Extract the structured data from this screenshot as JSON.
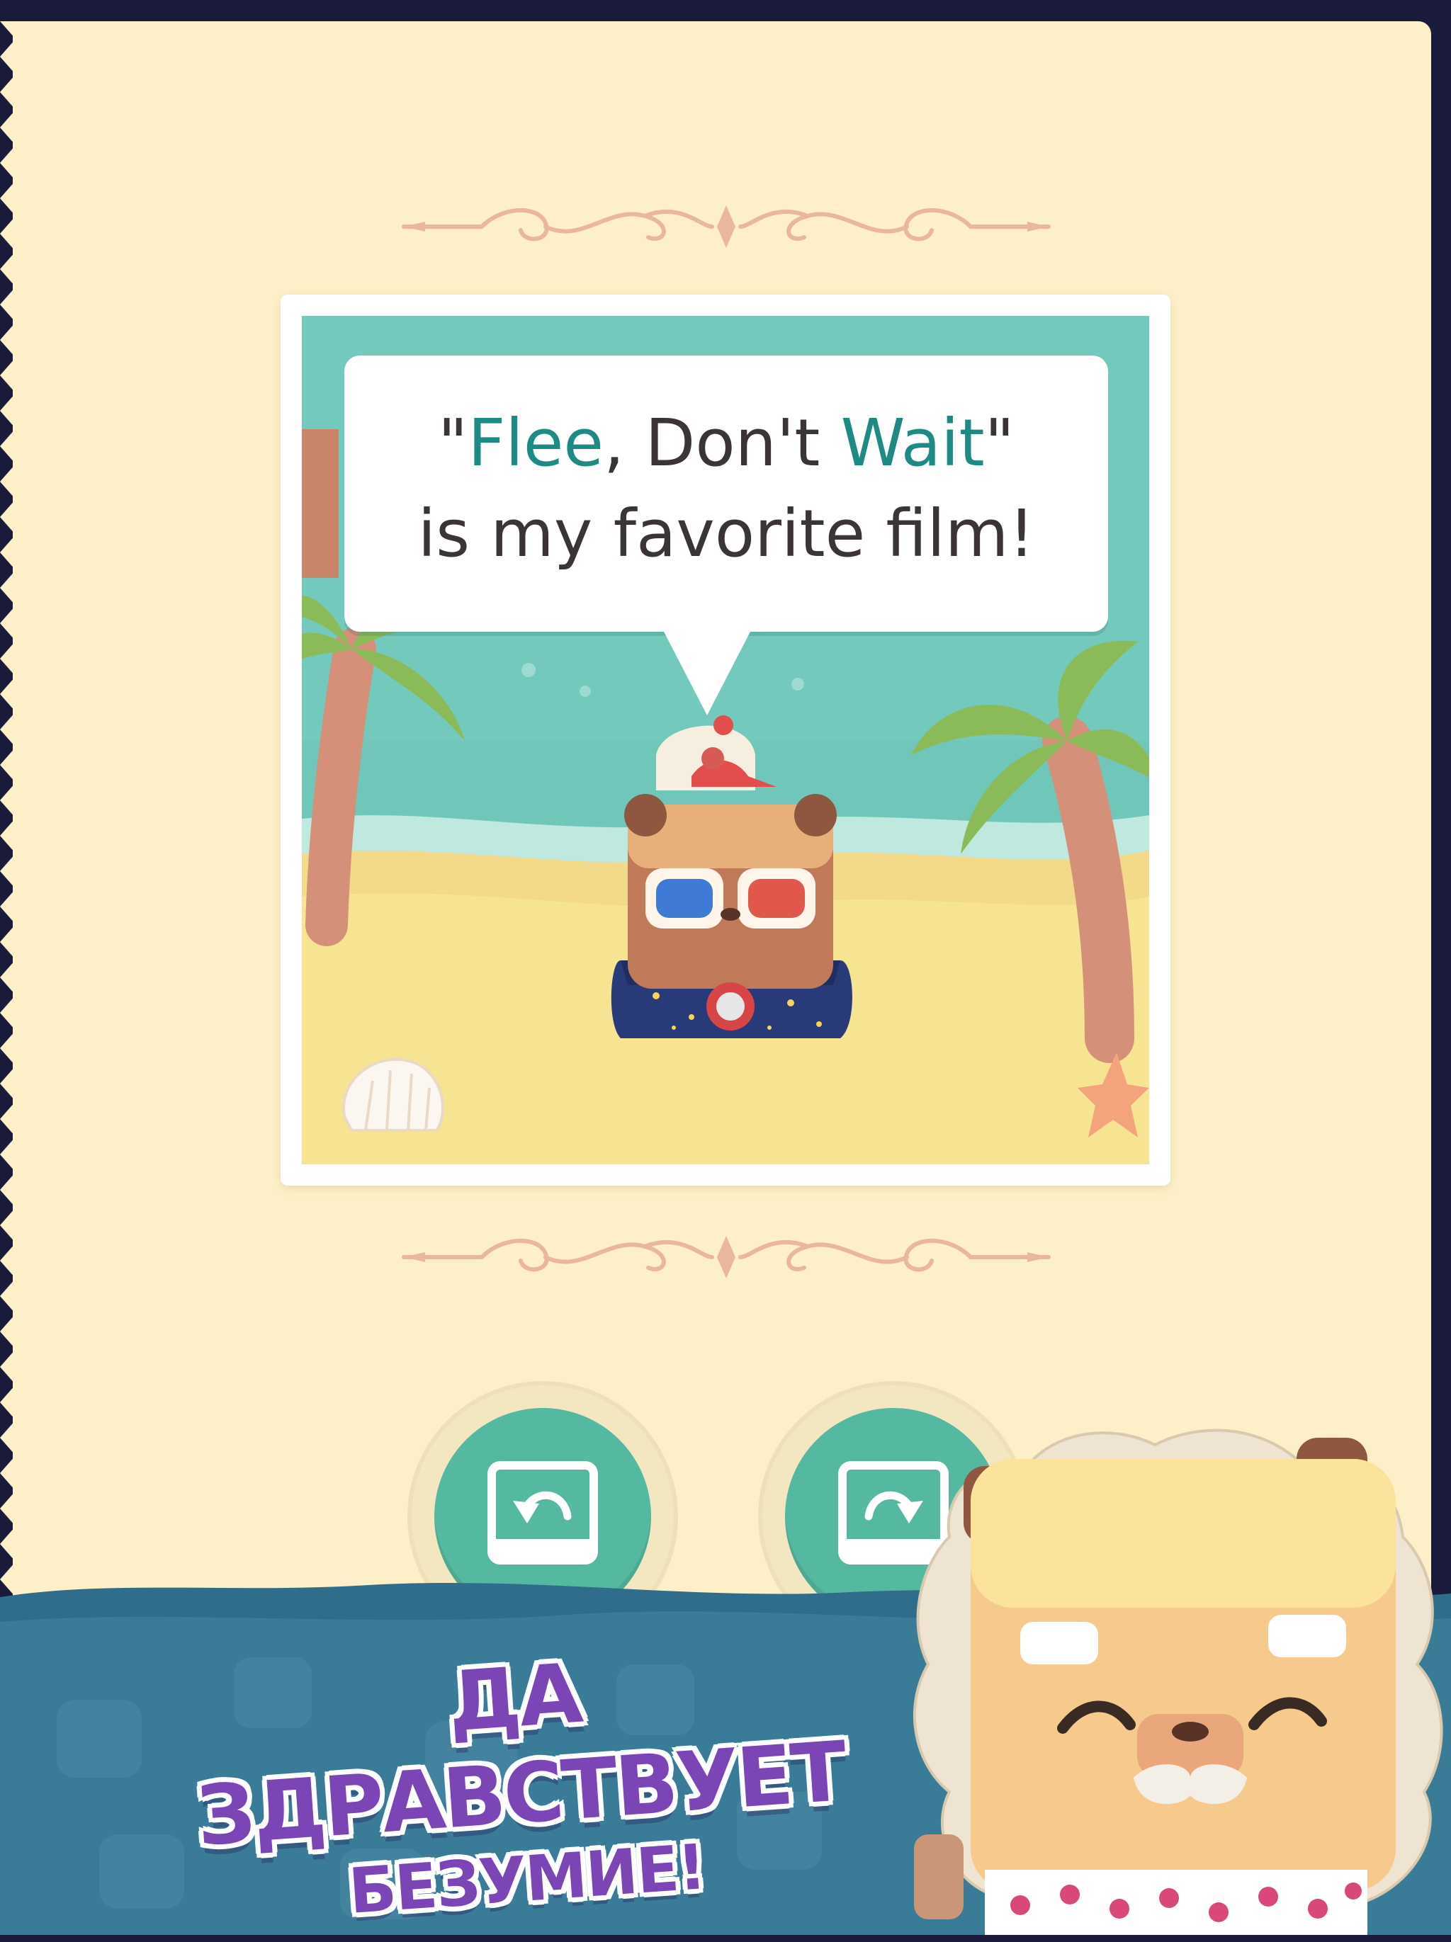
{
  "speech_bubble": {
    "quote_open": "\"",
    "title_word1": "Flee",
    "title_middle": ", Don't ",
    "title_word2": "Wait",
    "quote_close": "\"",
    "line2": "is my favorite film!"
  },
  "buttons": {
    "rotate_left_icon": "rotate-left-icon",
    "rotate_right_icon": "rotate-right-icon"
  },
  "promo": {
    "line1": "ДА ЗДРАВСТВУЕТ",
    "line2": "БЕЗУМИЕ!"
  },
  "colors": {
    "page": "#fdf0c8",
    "accent_teal": "#1d8a83",
    "button_green": "#55b8a0",
    "banner_blue": "#2f6d8a",
    "promo_purple": "#7b45b5"
  }
}
